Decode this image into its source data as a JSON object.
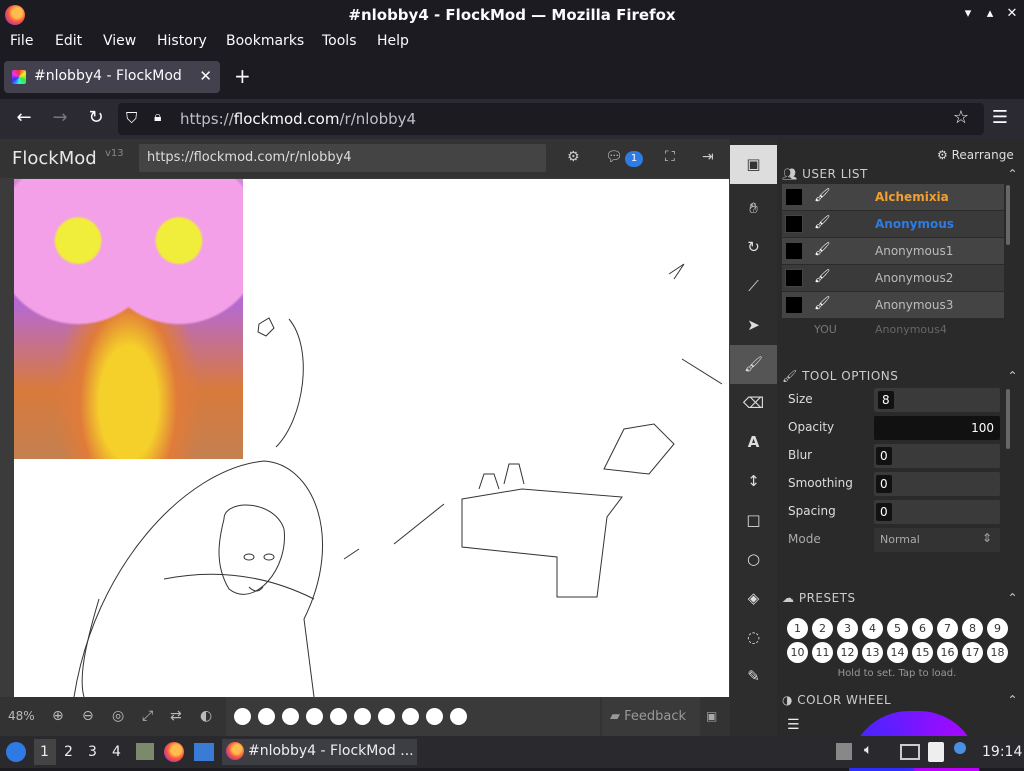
{
  "window": {
    "title": "#nlobby4 - FlockMod — Mozilla Firefox"
  },
  "menu": [
    "File",
    "Edit",
    "View",
    "History",
    "Bookmarks",
    "Tools",
    "Help"
  ],
  "tab": {
    "label": "#nlobby4 - FlockMod"
  },
  "url": {
    "prefix": "https://",
    "domain": "flockmod.com",
    "path": "/r/nlobby4"
  },
  "flockmod": {
    "logo": "FlockMod",
    "version": "v13",
    "room_url": "https://flockmod.com/r/nlobby4",
    "chat_count": "1",
    "zoom": "48%",
    "feedback": "Feedback",
    "rearrange": "Rearrange",
    "user_list_title": "USER LIST",
    "users": [
      {
        "name": "Alchemixia",
        "color": "#f0a030"
      },
      {
        "name": "Anonymous",
        "color": "#2d7be3"
      },
      {
        "name": "Anonymous1",
        "color": "#bbbbbb"
      },
      {
        "name": "Anonymous2",
        "color": "#bbbbbb"
      },
      {
        "name": "Anonymous3",
        "color": "#bbbbbb"
      }
    ],
    "you_label": "YOU",
    "you_name": "Anonymous4",
    "tool_options_title": "TOOL OPTIONS",
    "options": [
      {
        "label": "Size",
        "value": "8"
      },
      {
        "label": "Opacity",
        "value": "100"
      },
      {
        "label": "Blur",
        "value": "0"
      },
      {
        "label": "Smoothing",
        "value": "0"
      },
      {
        "label": "Spacing",
        "value": "0"
      }
    ],
    "mode_label": "Mode",
    "mode_value": "Normal",
    "presets_title": "PRESETS",
    "presets": [
      "1",
      "2",
      "3",
      "4",
      "5",
      "6",
      "7",
      "8",
      "9",
      "10",
      "11",
      "12",
      "13",
      "14",
      "15",
      "16",
      "17",
      "18"
    ],
    "presets_hint": "Hold to set. Tap to load.",
    "color_wheel_title": "COLOR WHEEL"
  },
  "taskbar": {
    "workspaces": [
      "1",
      "2",
      "3",
      "4"
    ],
    "task_label": "#nlobby4 - FlockMod ...",
    "clock": "19:14"
  }
}
